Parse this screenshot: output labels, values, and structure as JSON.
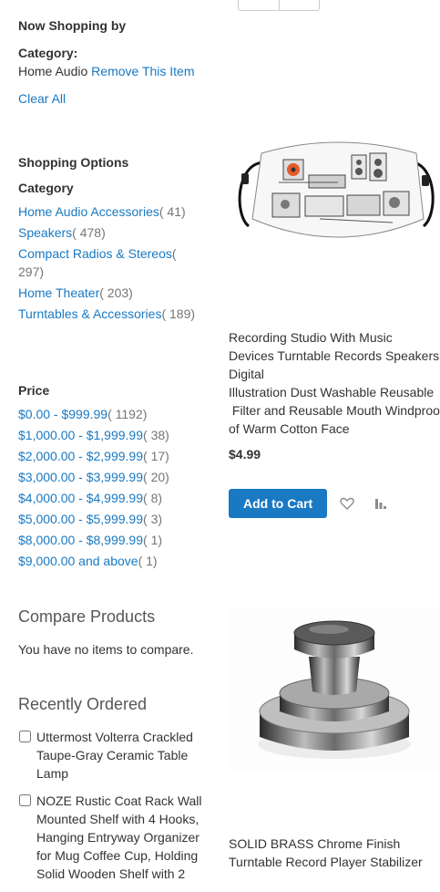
{
  "sidebar": {
    "now_shopping": {
      "title": "Now Shopping by",
      "filter_label": "Category:",
      "filter_value": "Home Audio",
      "remove_label": "Remove This Item",
      "clear_all": "Clear All"
    },
    "shopping_options": {
      "title": "Shopping Options",
      "category": {
        "title": "Category",
        "items": [
          {
            "label": "Home Audio Accessories",
            "count": "( 41)"
          },
          {
            "label": "Speakers",
            "count": "( 478)"
          },
          {
            "label": "Compact Radios & Stereos",
            "count": "( 297)"
          },
          {
            "label": "Home Theater",
            "count": "( 203)"
          },
          {
            "label": "Turntables & Accessories",
            "count": "( 189)"
          }
        ]
      },
      "price": {
        "title": "Price",
        "items": [
          {
            "label": "$0.00 - $999.99",
            "count": "( 1192)"
          },
          {
            "label": "$1,000.00 - $1,999.99",
            "count": "( 38)"
          },
          {
            "label": "$2,000.00 - $2,999.99",
            "count": "( 17)"
          },
          {
            "label": "$3,000.00 - $3,999.99",
            "count": "( 20)"
          },
          {
            "label": "$4,000.00 - $4,999.99",
            "count": "( 8)"
          },
          {
            "label": "$5,000.00 - $5,999.99",
            "count": "( 3)"
          },
          {
            "label": "$8,000.00 - $8,999.99",
            "count": "( 1)"
          },
          {
            "label": "$9,000.00 and above",
            "count": "( 1)"
          }
        ]
      }
    },
    "compare": {
      "title": "Compare Products",
      "empty": "You have no items to compare."
    },
    "recently_ordered": {
      "title": "Recently Ordered",
      "items": [
        {
          "label": "Uttermost Volterra Crackled Taupe-Gray Ceramic Table Lamp"
        },
        {
          "label": "NOZE Rustic Coat Rack Wall Mounted Shelf with 4 Hooks, Hanging Entryway Organizer for Mug Coffee Cup, Holding Solid Wooden Shelf with 2"
        }
      ]
    }
  },
  "products": [
    {
      "name_lines": [
        "Recording Studio With Music",
        "Devices Turntable Records Speakers",
        "Digital",
        "Illustration Dust Washable Reusable",
        " Filter and Reusable Mouth Windproof",
        "of Warm Cotton Face"
      ],
      "price": "$4.99",
      "add_to_cart": "Add to Cart",
      "wishlist_icon": "heart-icon",
      "compare_icon": "bar-chart-icon"
    },
    {
      "name_lines": [
        "SOLID BRASS Chrome Finish",
        "Turntable Record Player Stabilizer"
      ]
    }
  ],
  "colors": {
    "link": "#1979c3",
    "button": "#1979c3",
    "count": "#757575",
    "text": "#333333"
  }
}
